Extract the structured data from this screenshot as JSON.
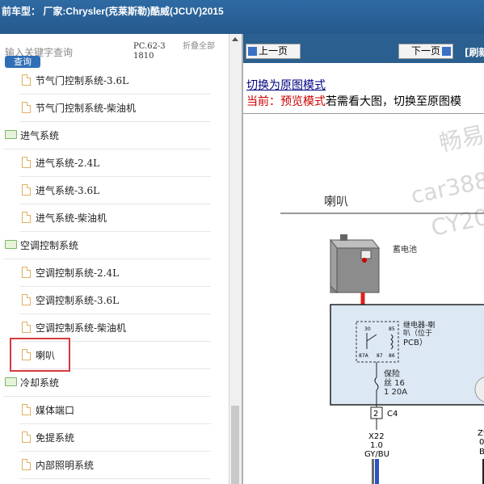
{
  "header": {
    "title": "前车型： 厂家:Chrysler(克莱斯勒)酷威(JCUV)2015"
  },
  "search": {
    "placeholder": "输入关键字查询",
    "button": "查询",
    "code": "PC.62-31810",
    "collapse": "折叠全部"
  },
  "tree": [
    {
      "type": "doc",
      "label": "节气门控制系统-3.6L"
    },
    {
      "type": "doc",
      "label": "节气门控制系统-柴油机"
    },
    {
      "type": "folder",
      "label": "进气系统"
    },
    {
      "type": "doc",
      "label": "进气系统-2.4L"
    },
    {
      "type": "doc",
      "label": "进气系统-3.6L"
    },
    {
      "type": "doc",
      "label": "进气系统-柴油机"
    },
    {
      "type": "folder",
      "label": "空调控制系统"
    },
    {
      "type": "doc",
      "label": "空调控制系统-2.4L"
    },
    {
      "type": "doc",
      "label": "空调控制系统-3.6L"
    },
    {
      "type": "doc",
      "label": "空调控制系统-柴油机"
    },
    {
      "type": "doc",
      "label": "喇叭",
      "selected": true
    },
    {
      "type": "folder",
      "label": "冷却系统"
    },
    {
      "type": "doc",
      "label": "媒体端口"
    },
    {
      "type": "doc",
      "label": "免提系统"
    },
    {
      "type": "doc",
      "label": "内部照明系统"
    }
  ],
  "nav": {
    "prev": "上一页",
    "next": "下一页",
    "refresh": "[刷新"
  },
  "content": {
    "switch_link": "切换为原图模式",
    "current_label": "当前：预览模式",
    "current_desc": "若需看大图，切换至原图模",
    "diagram": {
      "title": "喇叭",
      "battery": "蓄电池",
      "relay": "继电器-喇",
      "relay2": "叭（位于",
      "relay3": "PCB）",
      "fuse": "保险",
      "fuse2": "丝 16",
      "fuse3": "1 20A",
      "pin1": "2",
      "pin1b": "C4",
      "pin2": "Z9",
      "wire1a": "X22",
      "wire1b": "1.0",
      "wire1c": "GY/BU",
      "wire2b": "0.",
      "wire2c": "B",
      "relay_pins": [
        "30",
        "85",
        "86",
        "87A",
        "87"
      ],
      "watermark": [
        "畅易",
        "car388",
        "CY20"
      ]
    }
  },
  "colors": {
    "header_bg": "#2e6aa3",
    "nav_bg": "#2a5f8f",
    "highlight": "#d9393d",
    "link": "#000080",
    "red_text": "#cc0000",
    "diagram_box": "#dce8f4"
  }
}
